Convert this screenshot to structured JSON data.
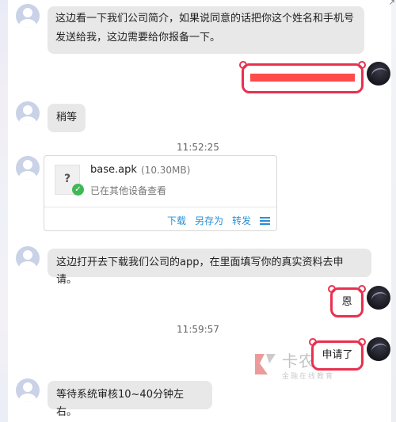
{
  "messages": {
    "m1": "这边看一下我们公司简介，如果说同意的话把你这个姓名和手机号发送给我，这边需要给你报备一下。",
    "m2": "稍等",
    "m3": "这边打开去下载我们公司的app，在里面填写你的真实资料去申请。",
    "m4": "恩",
    "m5": "申请了",
    "m6": "等待系统审核10~40分钟左右。"
  },
  "timestamps": {
    "t1": "11:52:25",
    "t2": "11:59:57"
  },
  "file": {
    "icon_glyph": "?",
    "name": "base.apk",
    "size": "(10.30MB)",
    "status": "已在其他设备查看",
    "actions": {
      "download": "下载",
      "save_as": "另存为",
      "forward": "转发"
    }
  },
  "watermark": {
    "title": "卡农社区",
    "subtitle": "金融在线教育"
  },
  "colors": {
    "accent": "#e8314f",
    "link": "#2a8fd4",
    "bubble": "#e8e8e8"
  },
  "icons": [
    "user-avatar-icon",
    "file-question-icon",
    "check-circle-icon",
    "menu-icon",
    "expand-arrow-icon"
  ]
}
